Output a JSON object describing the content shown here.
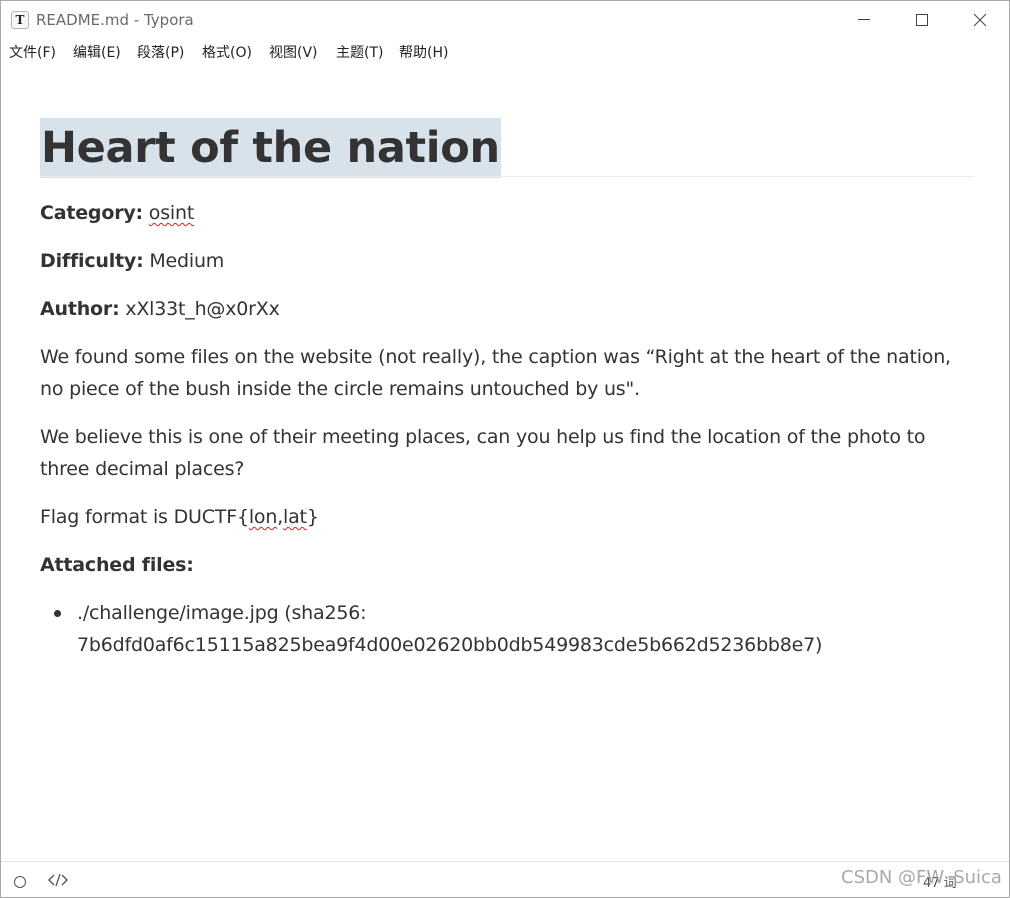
{
  "window": {
    "title": "README.md - Typora",
    "app_icon_letter": "T"
  },
  "menu": {
    "items": [
      {
        "label": "文件(F)"
      },
      {
        "label": "编辑(E)"
      },
      {
        "label": "段落(P)"
      },
      {
        "label": "格式(O)"
      },
      {
        "label": "视图(V)"
      },
      {
        "label": "主题(T)"
      },
      {
        "label": "帮助(H)"
      }
    ]
  },
  "document": {
    "heading": "Heart of the nation",
    "category_label": "Category:",
    "category_value": "osint",
    "difficulty_label": "Difficulty:",
    "difficulty_value": "Medium",
    "author_label": "Author:",
    "author_value": "xXl33t_h@x0rXx",
    "description_1": "We found some files on the website (not really), the caption was “Right at the heart of the nation, no piece of the bush inside the circle remains untouched by us\".",
    "description_2": "We believe this is one of their meeting places, can you help us find the location of the photo to three decimal places?",
    "flag_prefix": "Flag format is DUCTF{",
    "flag_lon": "lon",
    "flag_sep": ",",
    "flag_lat": "lat",
    "flag_suffix": "}",
    "attached_label": "Attached files:",
    "attachments": [
      {
        "text": "./challenge/image.jpg (sha256: 7b6dfd0af6c15115a825bea9f4d00e02620bb0db549983cde5b662d5236bb8e7)"
      }
    ]
  },
  "statusbar": {
    "word_count": "47 词"
  },
  "watermark": "CSDN @FW_Suica",
  "colors": {
    "heading_highlight": "#d7e2ea",
    "text": "#333333",
    "spellcheck": "#e02020"
  }
}
